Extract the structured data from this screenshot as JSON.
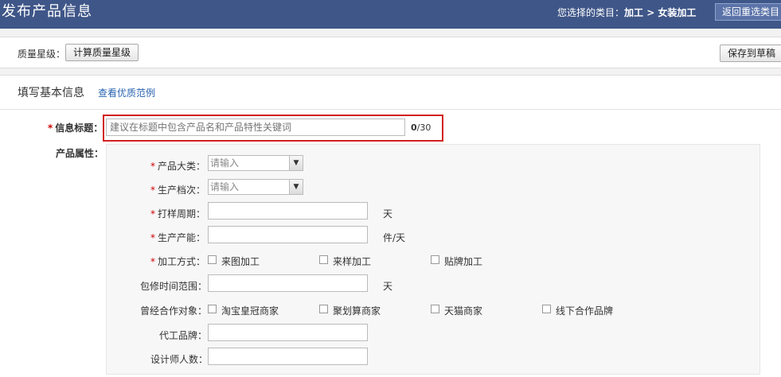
{
  "header": {
    "title": "发布产品信息",
    "category_prefix": "您选择的类目：",
    "category_path": "加工 > 女装加工",
    "reselect_label": "返回重选类目"
  },
  "quality": {
    "label": "质量星级：",
    "calc_button": "计算质量星级",
    "draft_button": "保存到草稿"
  },
  "basic": {
    "section_title": "填写基本信息",
    "example_link": "查看优质范例",
    "title_label": "信息标题：",
    "title_placeholder": "建议在标题中包含产品名和产品特性关键词",
    "counter_current": "0",
    "counter_max": "/30",
    "attr_label": "产品属性："
  },
  "attributes": {
    "category_label": "产品大类：",
    "category_value": "请输入",
    "grade_label": "生产档次：",
    "grade_value": "请输入",
    "sample_label": "打样周期：",
    "sample_unit": "天",
    "capacity_label": "生产产能：",
    "capacity_unit": "件/天",
    "method_label": "加工方式：",
    "method_options": [
      "来图加工",
      "来样加工",
      "贴牌加工"
    ],
    "warranty_label": "包修时间范围：",
    "warranty_unit": "天",
    "partners_label": "曾经合作对象：",
    "partner_options": [
      "淘宝皇冠商家",
      "聚划算商家",
      "天猫商家",
      "线下合作品牌"
    ],
    "oem_label": "代工品牌：",
    "designers_label": "设计师人数："
  },
  "colors": {
    "header_bg": "#3f5688",
    "required_star": "#cc0000",
    "highlight": "#d21f1f",
    "link": "#2a64b0"
  }
}
